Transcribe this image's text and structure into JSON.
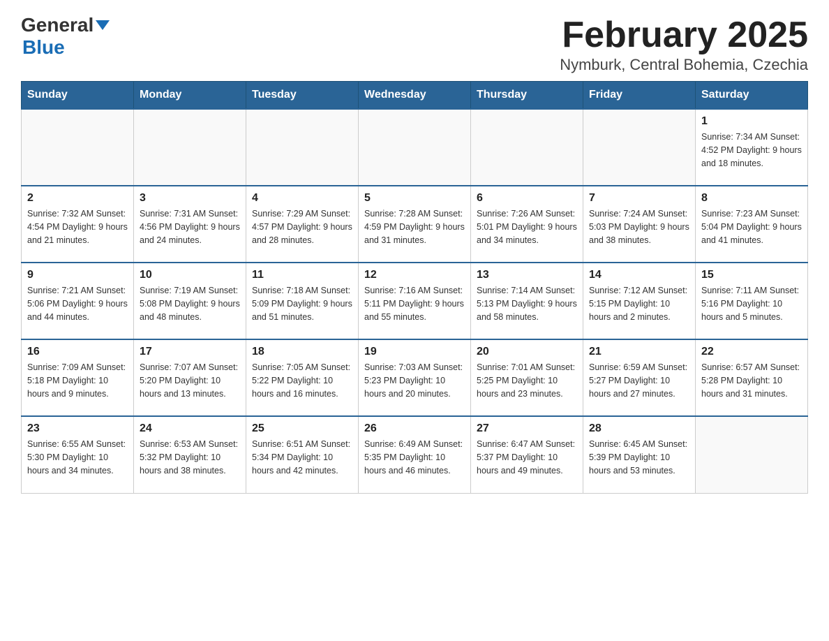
{
  "header": {
    "logo_general": "General",
    "logo_blue": "Blue",
    "title": "February 2025",
    "subtitle": "Nymburk, Central Bohemia, Czechia"
  },
  "days_of_week": [
    "Sunday",
    "Monday",
    "Tuesday",
    "Wednesday",
    "Thursday",
    "Friday",
    "Saturday"
  ],
  "weeks": [
    [
      {
        "num": "",
        "info": ""
      },
      {
        "num": "",
        "info": ""
      },
      {
        "num": "",
        "info": ""
      },
      {
        "num": "",
        "info": ""
      },
      {
        "num": "",
        "info": ""
      },
      {
        "num": "",
        "info": ""
      },
      {
        "num": "1",
        "info": "Sunrise: 7:34 AM\nSunset: 4:52 PM\nDaylight: 9 hours\nand 18 minutes."
      }
    ],
    [
      {
        "num": "2",
        "info": "Sunrise: 7:32 AM\nSunset: 4:54 PM\nDaylight: 9 hours\nand 21 minutes."
      },
      {
        "num": "3",
        "info": "Sunrise: 7:31 AM\nSunset: 4:56 PM\nDaylight: 9 hours\nand 24 minutes."
      },
      {
        "num": "4",
        "info": "Sunrise: 7:29 AM\nSunset: 4:57 PM\nDaylight: 9 hours\nand 28 minutes."
      },
      {
        "num": "5",
        "info": "Sunrise: 7:28 AM\nSunset: 4:59 PM\nDaylight: 9 hours\nand 31 minutes."
      },
      {
        "num": "6",
        "info": "Sunrise: 7:26 AM\nSunset: 5:01 PM\nDaylight: 9 hours\nand 34 minutes."
      },
      {
        "num": "7",
        "info": "Sunrise: 7:24 AM\nSunset: 5:03 PM\nDaylight: 9 hours\nand 38 minutes."
      },
      {
        "num": "8",
        "info": "Sunrise: 7:23 AM\nSunset: 5:04 PM\nDaylight: 9 hours\nand 41 minutes."
      }
    ],
    [
      {
        "num": "9",
        "info": "Sunrise: 7:21 AM\nSunset: 5:06 PM\nDaylight: 9 hours\nand 44 minutes."
      },
      {
        "num": "10",
        "info": "Sunrise: 7:19 AM\nSunset: 5:08 PM\nDaylight: 9 hours\nand 48 minutes."
      },
      {
        "num": "11",
        "info": "Sunrise: 7:18 AM\nSunset: 5:09 PM\nDaylight: 9 hours\nand 51 minutes."
      },
      {
        "num": "12",
        "info": "Sunrise: 7:16 AM\nSunset: 5:11 PM\nDaylight: 9 hours\nand 55 minutes."
      },
      {
        "num": "13",
        "info": "Sunrise: 7:14 AM\nSunset: 5:13 PM\nDaylight: 9 hours\nand 58 minutes."
      },
      {
        "num": "14",
        "info": "Sunrise: 7:12 AM\nSunset: 5:15 PM\nDaylight: 10 hours\nand 2 minutes."
      },
      {
        "num": "15",
        "info": "Sunrise: 7:11 AM\nSunset: 5:16 PM\nDaylight: 10 hours\nand 5 minutes."
      }
    ],
    [
      {
        "num": "16",
        "info": "Sunrise: 7:09 AM\nSunset: 5:18 PM\nDaylight: 10 hours\nand 9 minutes."
      },
      {
        "num": "17",
        "info": "Sunrise: 7:07 AM\nSunset: 5:20 PM\nDaylight: 10 hours\nand 13 minutes."
      },
      {
        "num": "18",
        "info": "Sunrise: 7:05 AM\nSunset: 5:22 PM\nDaylight: 10 hours\nand 16 minutes."
      },
      {
        "num": "19",
        "info": "Sunrise: 7:03 AM\nSunset: 5:23 PM\nDaylight: 10 hours\nand 20 minutes."
      },
      {
        "num": "20",
        "info": "Sunrise: 7:01 AM\nSunset: 5:25 PM\nDaylight: 10 hours\nand 23 minutes."
      },
      {
        "num": "21",
        "info": "Sunrise: 6:59 AM\nSunset: 5:27 PM\nDaylight: 10 hours\nand 27 minutes."
      },
      {
        "num": "22",
        "info": "Sunrise: 6:57 AM\nSunset: 5:28 PM\nDaylight: 10 hours\nand 31 minutes."
      }
    ],
    [
      {
        "num": "23",
        "info": "Sunrise: 6:55 AM\nSunset: 5:30 PM\nDaylight: 10 hours\nand 34 minutes."
      },
      {
        "num": "24",
        "info": "Sunrise: 6:53 AM\nSunset: 5:32 PM\nDaylight: 10 hours\nand 38 minutes."
      },
      {
        "num": "25",
        "info": "Sunrise: 6:51 AM\nSunset: 5:34 PM\nDaylight: 10 hours\nand 42 minutes."
      },
      {
        "num": "26",
        "info": "Sunrise: 6:49 AM\nSunset: 5:35 PM\nDaylight: 10 hours\nand 46 minutes."
      },
      {
        "num": "27",
        "info": "Sunrise: 6:47 AM\nSunset: 5:37 PM\nDaylight: 10 hours\nand 49 minutes."
      },
      {
        "num": "28",
        "info": "Sunrise: 6:45 AM\nSunset: 5:39 PM\nDaylight: 10 hours\nand 53 minutes."
      },
      {
        "num": "",
        "info": ""
      }
    ]
  ]
}
